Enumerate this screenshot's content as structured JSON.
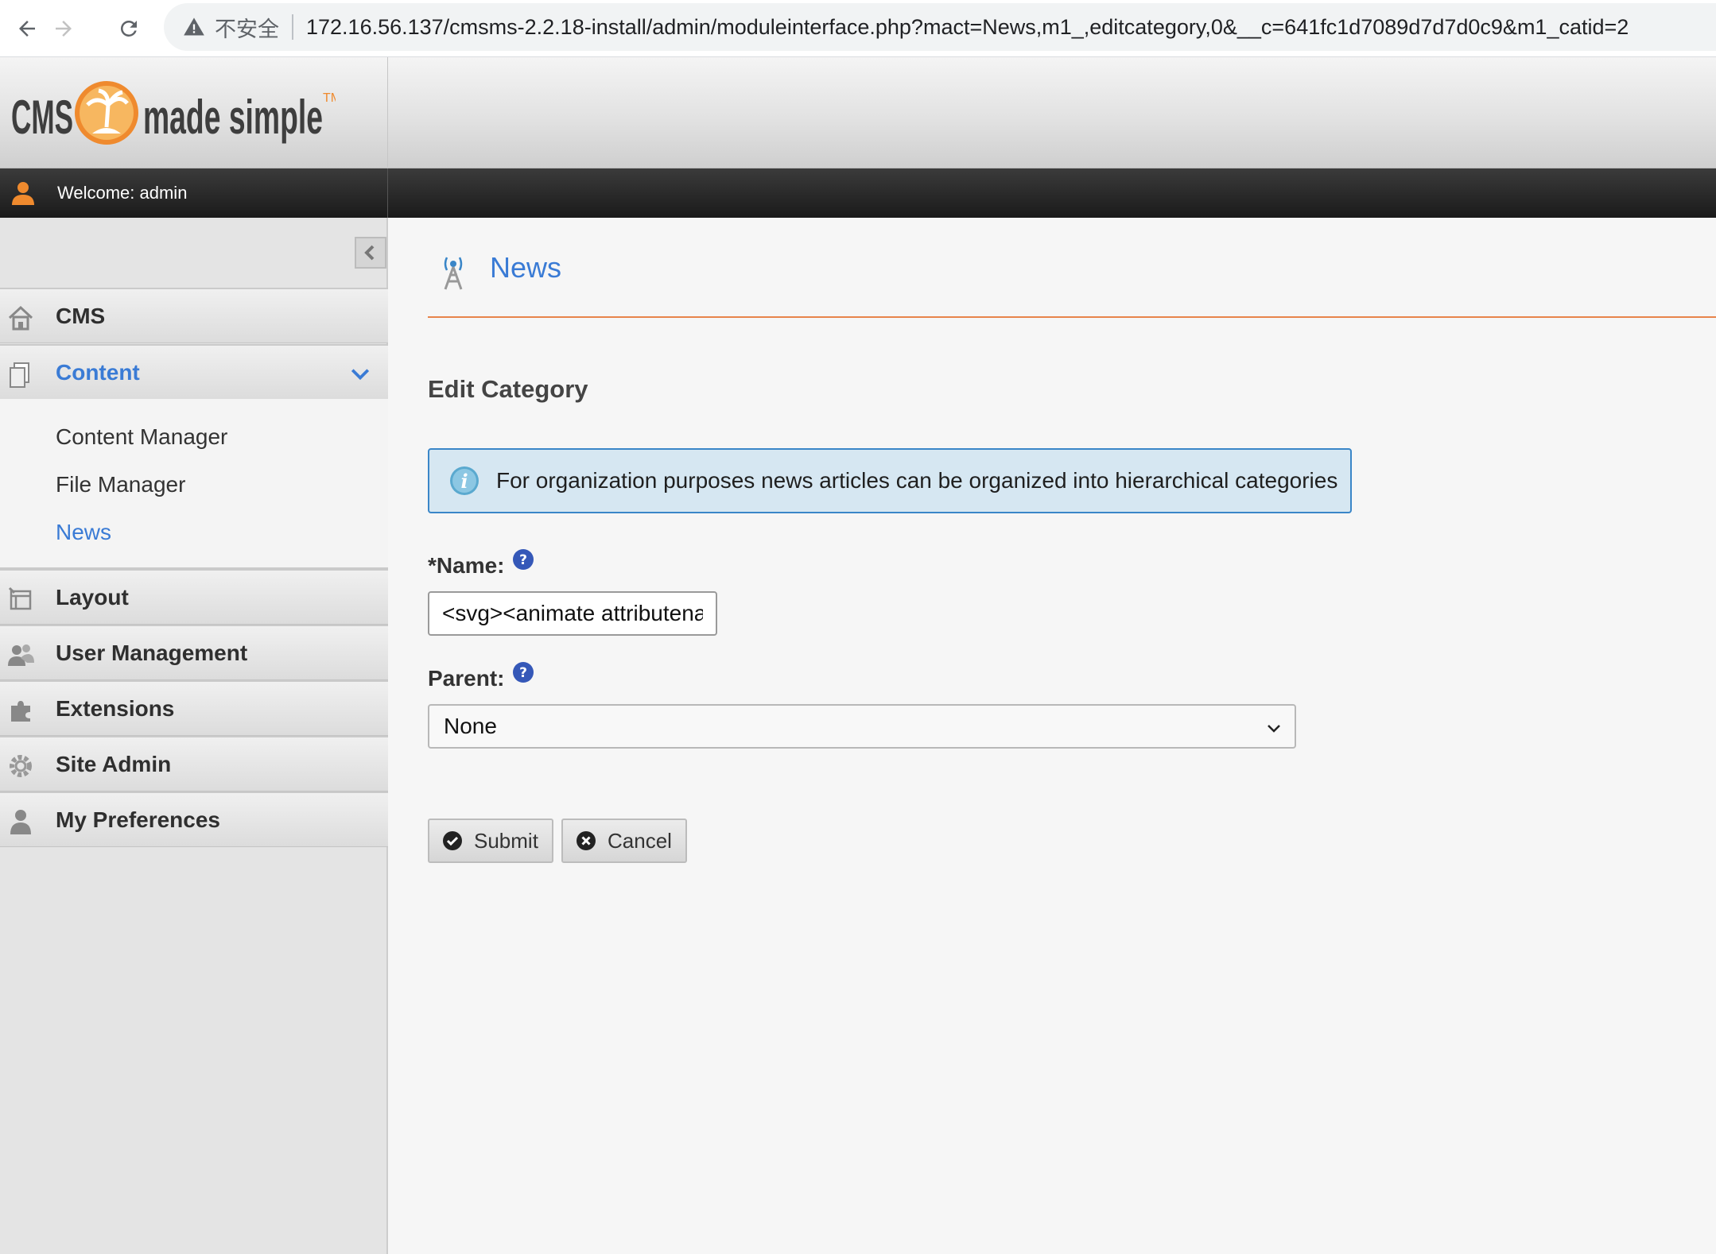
{
  "browser": {
    "insecure_label": "不安全",
    "url": "172.16.56.137/cmsms-2.2.18-install/admin/moduleinterface.php?mact=News,m1_,editcategory,0&__c=641fc1d7089d7d7d0c9&m1_catid=2"
  },
  "header": {
    "logo_text": "CMS Made Simple™",
    "welcome": "Welcome: admin"
  },
  "sidebar": {
    "items": [
      {
        "label": "CMS",
        "icon": "home-icon"
      },
      {
        "label": "Content",
        "icon": "content-icon",
        "active": true
      },
      {
        "label": "Layout",
        "icon": "layout-icon"
      },
      {
        "label": "User Management",
        "icon": "users-icon"
      },
      {
        "label": "Extensions",
        "icon": "puzzle-icon"
      },
      {
        "label": "Site Admin",
        "icon": "gear-icon"
      },
      {
        "label": "My Preferences",
        "icon": "user-icon"
      }
    ],
    "submenu": [
      "Content Manager",
      "File Manager",
      "News"
    ]
  },
  "main": {
    "module_title": "News",
    "section_title": "Edit Category",
    "info_text": "For organization purposes news articles can be organized into hierarchical categories",
    "name_label": "*Name:",
    "name_value": "<svg><animate attributena",
    "parent_label": "Parent:",
    "parent_value": "None",
    "submit_label": "Submit",
    "cancel_label": "Cancel"
  },
  "colors": {
    "accent_blue": "#3a7bd5",
    "rule_orange": "#e8844a",
    "info_bg": "#d6e7f2"
  }
}
